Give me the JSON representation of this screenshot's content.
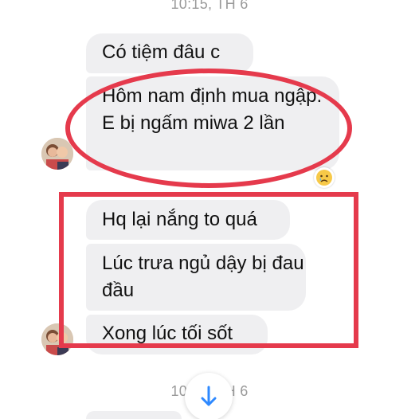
{
  "timestamps": {
    "top": "10:15, TH 6",
    "bottom": "10:46, TH 6"
  },
  "messages": [
    {
      "text": "Có tiệm đâu c"
    },
    {
      "text": "Hôm nam định mua ngập. E bị ngấm miwa 2 lần"
    },
    {
      "text": "Hq lại nắng to quá"
    },
    {
      "text": "Lúc trưa ngủ dậy bị đau đầu"
    },
    {
      "text": "Xong lúc tối sốt"
    }
  ],
  "reaction": {
    "icon": "crying-emoji-icon",
    "emoji": "😢"
  },
  "annotations": {
    "color": "#e53a4c"
  },
  "icons": {
    "scroll_down": "arrow-down-icon"
  }
}
